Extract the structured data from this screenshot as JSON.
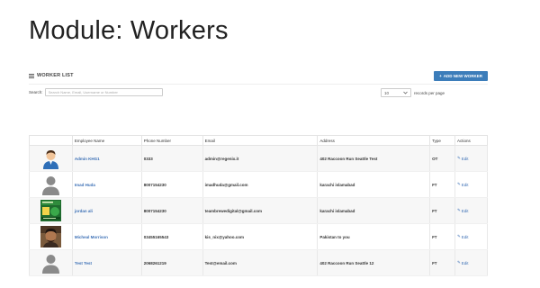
{
  "page": {
    "title": "Module: Workers"
  },
  "panel": {
    "title": "WORKER LIST",
    "add_button": "ADD NEW WORKER"
  },
  "search": {
    "label": "Search:",
    "placeholder": "Search Name, Email, Username or Number"
  },
  "paging": {
    "selected": "10",
    "suffix": "records per page"
  },
  "table": {
    "headers": [
      "",
      "Employee Name",
      "Phone Number",
      "Email",
      "Address",
      "Type",
      "Actions"
    ],
    "rows": [
      {
        "photo": "cartoon-avatar",
        "name": "Admin KHG1",
        "phone": "0333",
        "email": "admin@regenix.it",
        "address": "402 Raccoon Run Seattle Test",
        "type": "OT",
        "action": "Edit"
      },
      {
        "photo": "placeholder-silhouette",
        "name": "Imad Huda",
        "phone": "8007154230",
        "email": "imadhuda@gmail.com",
        "address": "karachi islamabad",
        "type": "FT",
        "action": "Edit"
      },
      {
        "photo": "green-poster",
        "name": "jordan ali",
        "phone": "8007154230",
        "email": "teambrewedigital@gmail.com",
        "address": "karachi islamabad",
        "type": "FT",
        "action": "Edit"
      },
      {
        "photo": "man-portrait",
        "name": "Micheal Morrison",
        "phone": "03455165543",
        "email": "kis_nix@yahoo.com",
        "address": "Pakistan to you",
        "type": "FT",
        "action": "Edit"
      },
      {
        "photo": "placeholder-silhouette",
        "name": "Test Test",
        "phone": "2068261219",
        "email": "Test@email.com",
        "address": "402 Raccoon Run Seattle 12",
        "type": "FT",
        "action": "Edit"
      }
    ]
  },
  "colors": {
    "accent": "#3c7dba",
    "link": "#3b6fb5"
  }
}
